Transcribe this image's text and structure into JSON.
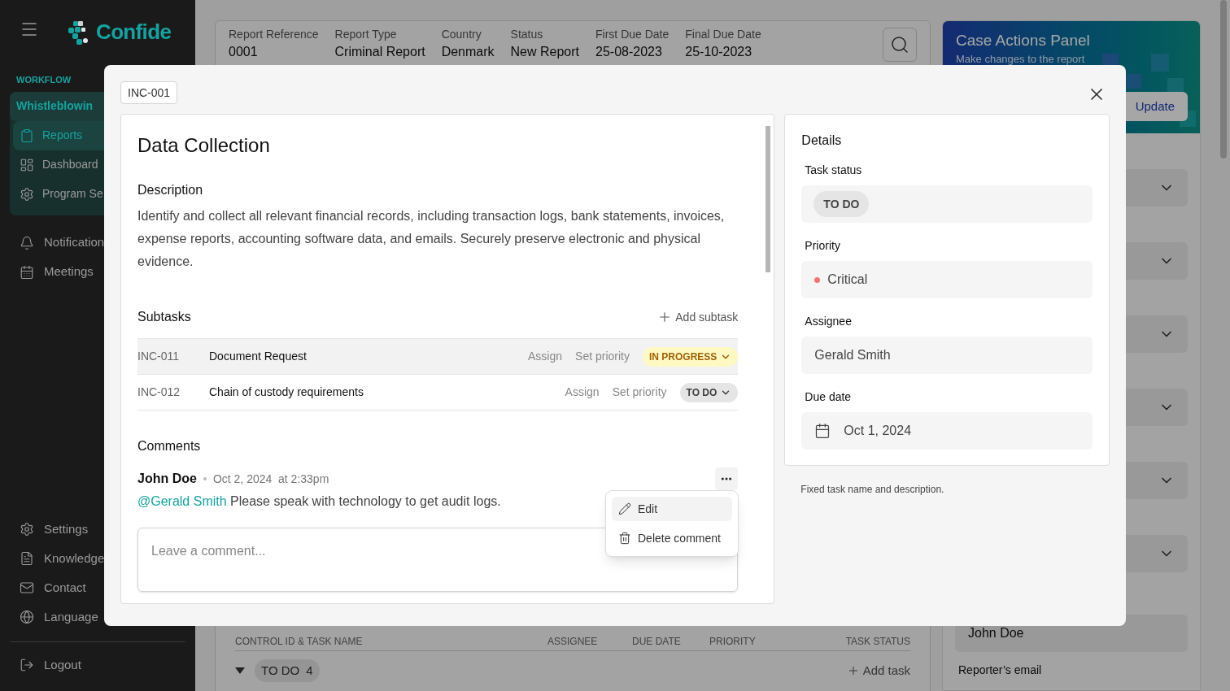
{
  "sidebar": {
    "brand": "Confide",
    "section": "WORKFLOW",
    "group_title": "Whistleblowin",
    "items": [
      {
        "label": "Reports",
        "selected": true
      },
      {
        "label": "Dashboard",
        "selected": false
      },
      {
        "label": "Program Se",
        "selected": false
      }
    ],
    "secondary_items": [
      "Notification",
      "Meetings"
    ],
    "bottom_items": [
      "Settings",
      "Knowledge",
      "Contact",
      "Language"
    ],
    "logout": "Logout"
  },
  "report_header": {
    "fields": [
      {
        "label": "Report Reference",
        "value": "0001"
      },
      {
        "label": "Report Type",
        "value": "Criminal Report"
      },
      {
        "label": "Country",
        "value": "Denmark"
      },
      {
        "label": "Status",
        "value": "New Report"
      },
      {
        "label": "First Due Date",
        "value": "25-08-2023"
      },
      {
        "label": "Final Due Date",
        "value": "25-10-2023"
      }
    ]
  },
  "case_actions_panel": {
    "title": "Case Actions Panel",
    "subtitle": "Make changes to the report",
    "button": "Update",
    "reporter_name": "John Doe",
    "reporter_email_label": "Reporter’s email"
  },
  "task_table": {
    "columns": [
      "CONTROL ID & TASK NAME",
      "ASSIGNEE",
      "DUE DATE",
      "PRIORITY",
      "TASK STATUS"
    ],
    "groups": [
      {
        "label": "TO DO",
        "count": "4",
        "expanded": true
      }
    ],
    "add_task": "Add task"
  },
  "modal": {
    "tag": "INC-001",
    "title": "Data Collection",
    "description_heading": "Description",
    "description": "Identify and collect all relevant financial records, including transaction logs, bank statements, invoices, expense reports, accounting software data, and emails. Securely preserve electronic and physical evidence.",
    "subtasks_heading": "Subtasks",
    "add_subtask": "Add subtask",
    "subtasks": [
      {
        "id": "INC-011",
        "name": "Document Request",
        "assign": "Assign",
        "set_priority": "Set priority",
        "status": "IN PROGRESS",
        "kind": "in_progress",
        "selected": true
      },
      {
        "id": "INC-012",
        "name": "Chain of custody requirements",
        "assign": "Assign",
        "set_priority": "Set priority",
        "status": "TO DO",
        "kind": "todo",
        "selected": false
      }
    ],
    "comments_heading": "Comments",
    "comment": {
      "author": "John Doe",
      "date": "Oct 2, 2024  at 2:33pm",
      "mention": "@Gerald Smith",
      "text": "Please speak with technology to get audit logs."
    },
    "comment_placeholder": "Leave a comment...",
    "menu": [
      {
        "label": "Edit",
        "selected": true
      },
      {
        "label": "Delete comment",
        "selected": false
      }
    ],
    "details": {
      "heading": "Details",
      "task_status_label": "Task status",
      "task_status": "TO DO",
      "priority_label": "Priority",
      "priority": {
        "value": "Critical",
        "color": "#f87171"
      },
      "assignee_label": "Assignee",
      "assignee": "Gerald Smith",
      "due_date_label": "Due date",
      "due_date": "Oct 1, 2024"
    },
    "footnote": "Fixed task name and description."
  }
}
